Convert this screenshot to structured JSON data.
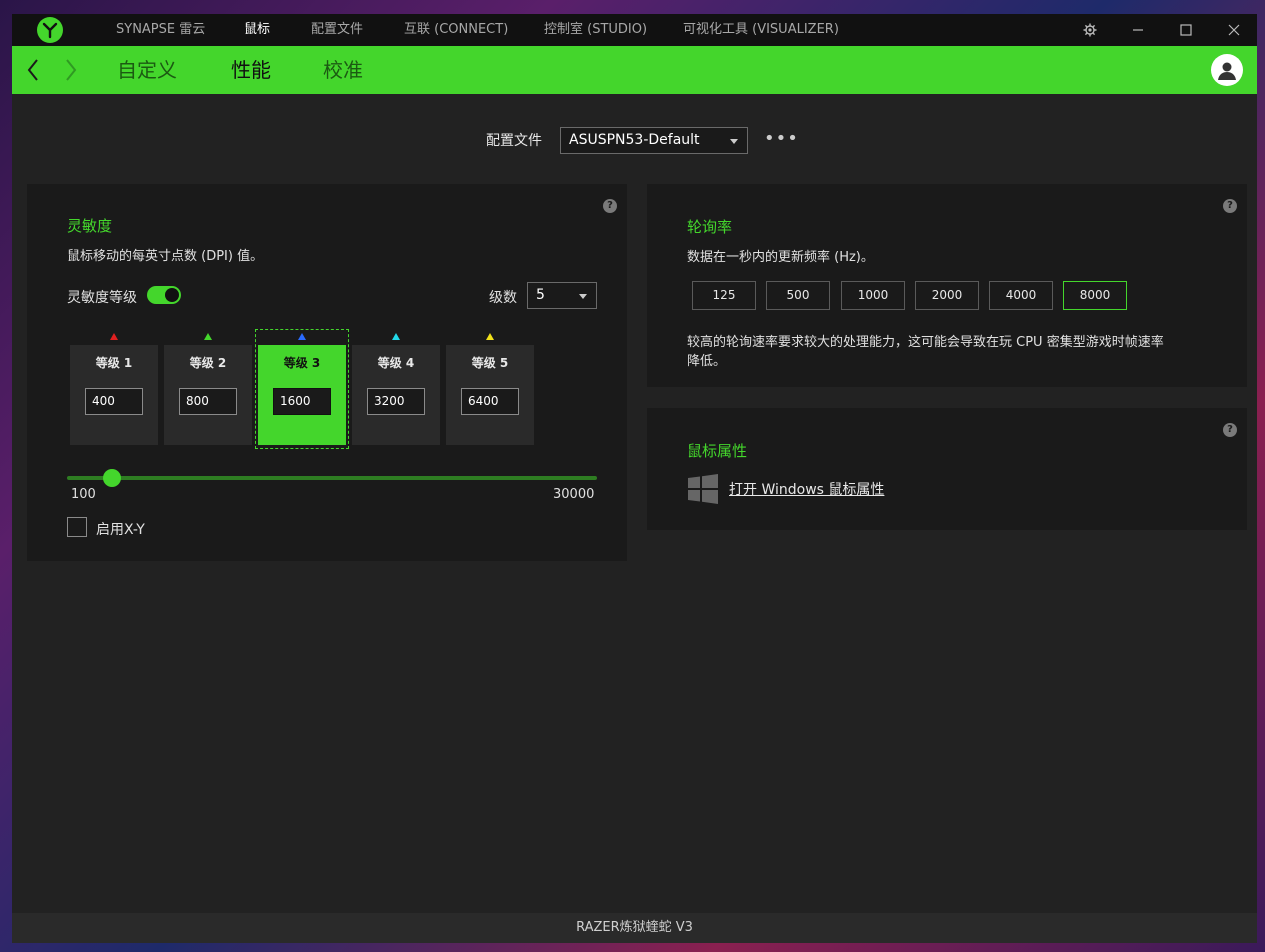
{
  "titlebar": {
    "tabs": [
      {
        "label": "SYNAPSE 雷云",
        "active": false
      },
      {
        "label": "鼠标",
        "active": true
      },
      {
        "label": "配置文件",
        "active": false
      },
      {
        "label": "互联 (CONNECT)",
        "active": false
      },
      {
        "label": "控制室 (STUDIO)",
        "active": false
      },
      {
        "label": "可视化工具 (VISUALIZER)",
        "active": false
      }
    ],
    "controls": [
      "gear-icon",
      "minimize-icon",
      "maximize-icon",
      "close-icon"
    ]
  },
  "subnav": {
    "tabs": [
      {
        "label": "自定义",
        "active": false
      },
      {
        "label": "性能",
        "active": true
      },
      {
        "label": "校准",
        "active": false
      }
    ]
  },
  "profile": {
    "label": "配置文件",
    "selected": "ASUSPN53-Default",
    "more": "•••"
  },
  "sensitivity": {
    "title": "灵敏度",
    "description": "鼠标移动的每英寸点数 (DPI) 值。",
    "stages_toggle_label": "灵敏度等级",
    "stages_toggle_on": true,
    "stage_count_label": "级数",
    "stage_count": "5",
    "stages": [
      {
        "label": "等级 1",
        "value": "400",
        "color": "#e02020",
        "active": false
      },
      {
        "label": "等级 2",
        "value": "800",
        "color": "#44d62c",
        "active": false
      },
      {
        "label": "等级 3",
        "value": "1600",
        "color": "#2a6bff",
        "active": true
      },
      {
        "label": "等级 4",
        "value": "3200",
        "color": "#22d8e8",
        "active": false
      },
      {
        "label": "等级 5",
        "value": "6400",
        "color": "#f2e21a",
        "active": false
      }
    ],
    "slider_min": "100",
    "slider_max": "30000",
    "slider_value": 1600,
    "xy_label": "启用X-Y",
    "xy_checked": false
  },
  "polling": {
    "title": "轮询率",
    "description": "数据在一秒内的更新频率 (Hz)。",
    "rates": [
      "125",
      "500",
      "1000",
      "2000",
      "4000",
      "8000"
    ],
    "selected": "8000",
    "note_line1": "较高的轮询速率要求较大的处理能力，这可能会导致在玩 CPU 密集型游戏时帧速率",
    "note_line2": "降低。"
  },
  "mouse_properties": {
    "title": "鼠标属性",
    "link": "打开 Windows 鼠标属性"
  },
  "statusbar": {
    "device": "RAZER炼狱蝰蛇 V3"
  },
  "colors": {
    "accent": "#44d62c",
    "background": "#222222",
    "panel": "#1a1a1a"
  }
}
